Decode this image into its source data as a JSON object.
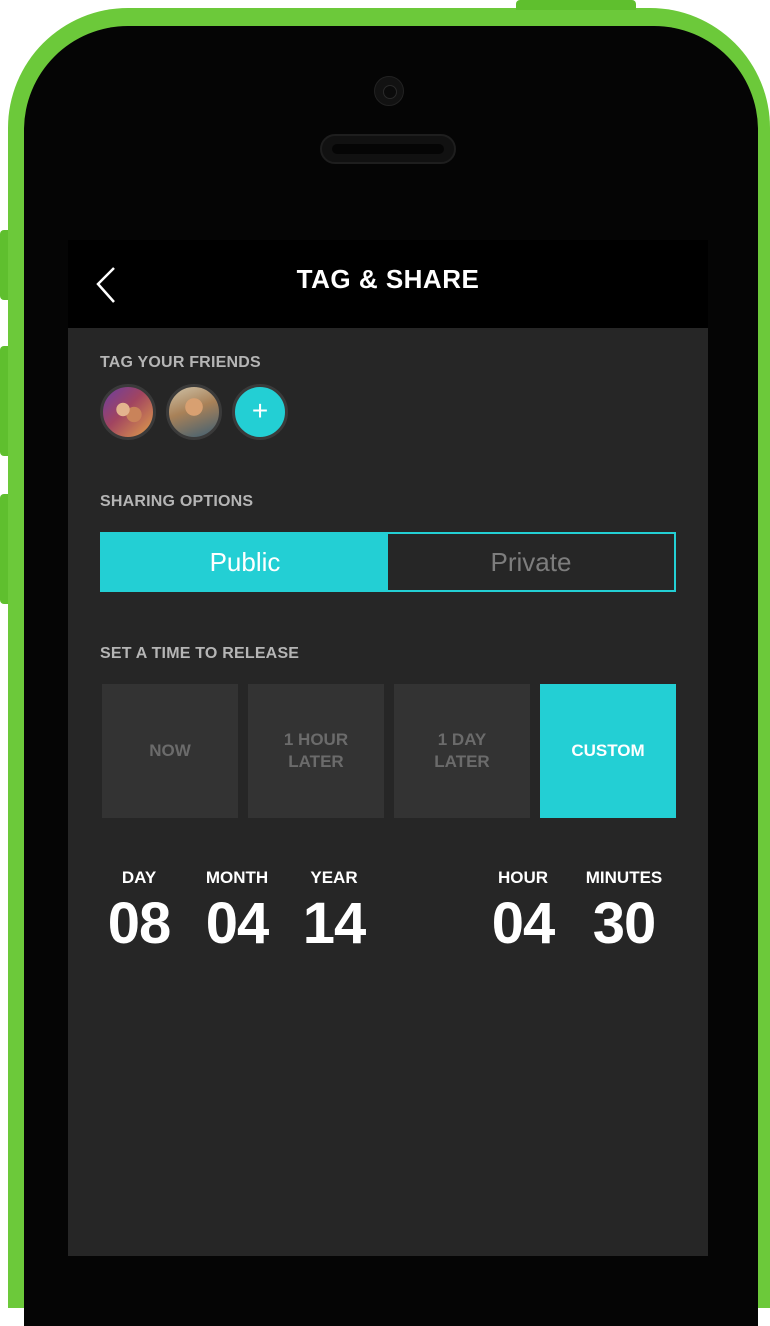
{
  "navbar": {
    "title": "TAG & SHARE",
    "back_icon": "chevron-left-icon"
  },
  "tag_friends": {
    "label": "TAG YOUR FRIENDS",
    "add_button_label": "+"
  },
  "sharing": {
    "label": "SHARING OPTIONS",
    "options": [
      "Public",
      "Private"
    ],
    "selected": "Public"
  },
  "release": {
    "label": "SET A TIME TO RELEASE",
    "options": [
      {
        "line1": "NOW",
        "line2": ""
      },
      {
        "line1": "1 HOUR",
        "line2": "LATER"
      },
      {
        "line1": "1 DAY",
        "line2": "LATER"
      },
      {
        "line1": "CUSTOM",
        "line2": ""
      }
    ],
    "selected": "CUSTOM"
  },
  "datetime": {
    "day_label": "DAY",
    "day": "08",
    "month_label": "MONTH",
    "month": "04",
    "year_label": "YEAR",
    "year": "14",
    "hour_label": "HOUR",
    "hour": "04",
    "minutes_label": "MINUTES",
    "minutes": "30"
  },
  "colors": {
    "accent": "#23cfd4",
    "device_frame": "#6cc93a",
    "screen_bg": "#262626",
    "navbar_bg": "#000000"
  }
}
